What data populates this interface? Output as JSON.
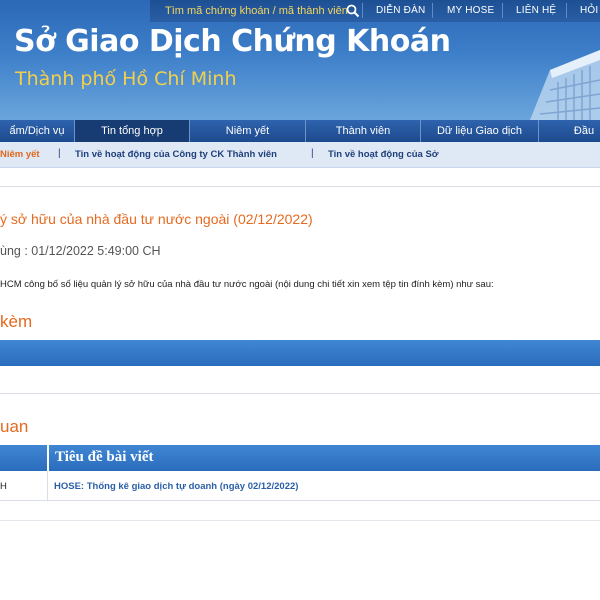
{
  "header": {
    "search_hint": "Tìm mã chứng khoán / mã thành viên",
    "top_links": [
      "DIỄN ĐÀN",
      "MY HOSE",
      "LIÊN HỆ",
      "HỎI"
    ],
    "site_title": "Sở Giao Dịch Chứng Khoán",
    "site_subtitle": "Thành phố Hồ Chí Minh",
    "accent_color": "#f3d04a"
  },
  "main_nav": {
    "items": [
      "ẩm/Dịch vụ",
      "Tin tổng hợp",
      "Niêm yết",
      "Thành viên",
      "Dữ liệu Giao dịch",
      "Đầu"
    ],
    "active_index": 1
  },
  "sub_nav": {
    "items": [
      "Niêm yết",
      "Tin về hoạt động của Công ty CK Thành viên",
      "Tin về hoạt động của Sở"
    ],
    "separator": "|",
    "active_index": 0
  },
  "article": {
    "title": "ý sở hữu của nhà đầu tư nước ngoài (02/12/2022)",
    "date": "ùng : 01/12/2022 5:49:00 CH",
    "body": "HCM công bố số liệu quản lý sở hữu của nhà đầu tư nước ngoài (nội dung chi tiết xin xem tệp tin đính kèm) như sau:",
    "title_color": "#e46a20"
  },
  "attachments": {
    "heading": "kèm"
  },
  "related": {
    "heading": "uan",
    "column_title": "Tiêu đề bài viết",
    "rows": [
      {
        "first": "H",
        "link": "HOSE: Thống kê giao dịch tự doanh (ngày 02/12/2022)"
      }
    ]
  }
}
